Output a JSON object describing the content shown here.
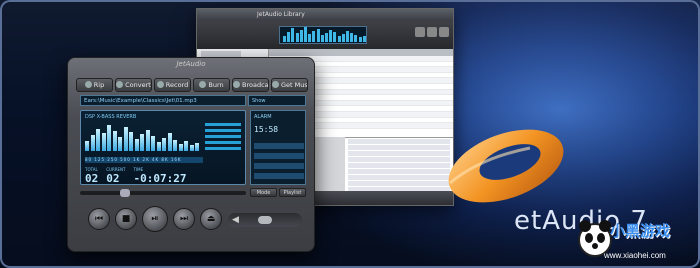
{
  "player": {
    "title": "JetAudio",
    "tabs": [
      "Rip",
      "Convert",
      "Record",
      "Burn",
      "Broadcast",
      "Get Music"
    ],
    "path": "Ears:\\Music\\Example\\Classics\\Jet\\01.mp3",
    "path_btn": "Show",
    "eq_header": "DSP  X-BASS   REVERB",
    "eq_labels": "80  125  250  500  1K  2K  4K  8K  16K",
    "counters": [
      {
        "label": "TOTAL",
        "value": "02"
      },
      {
        "label": "CURRENT",
        "value": "02"
      },
      {
        "label": "TIME",
        "value": "-0:07:27"
      }
    ],
    "right_panel": {
      "label": "ALARM",
      "time": "15:58"
    },
    "small_buttons": [
      "Mode",
      "Playlist"
    ],
    "controls": [
      "prev",
      "stop",
      "play",
      "next",
      "open"
    ]
  },
  "brand": {
    "version_text": "7"
  },
  "watermark": {
    "cn": "小黑游戏",
    "url": "www.xiaohei.com"
  },
  "library": {
    "title": "JetAudio Library"
  }
}
